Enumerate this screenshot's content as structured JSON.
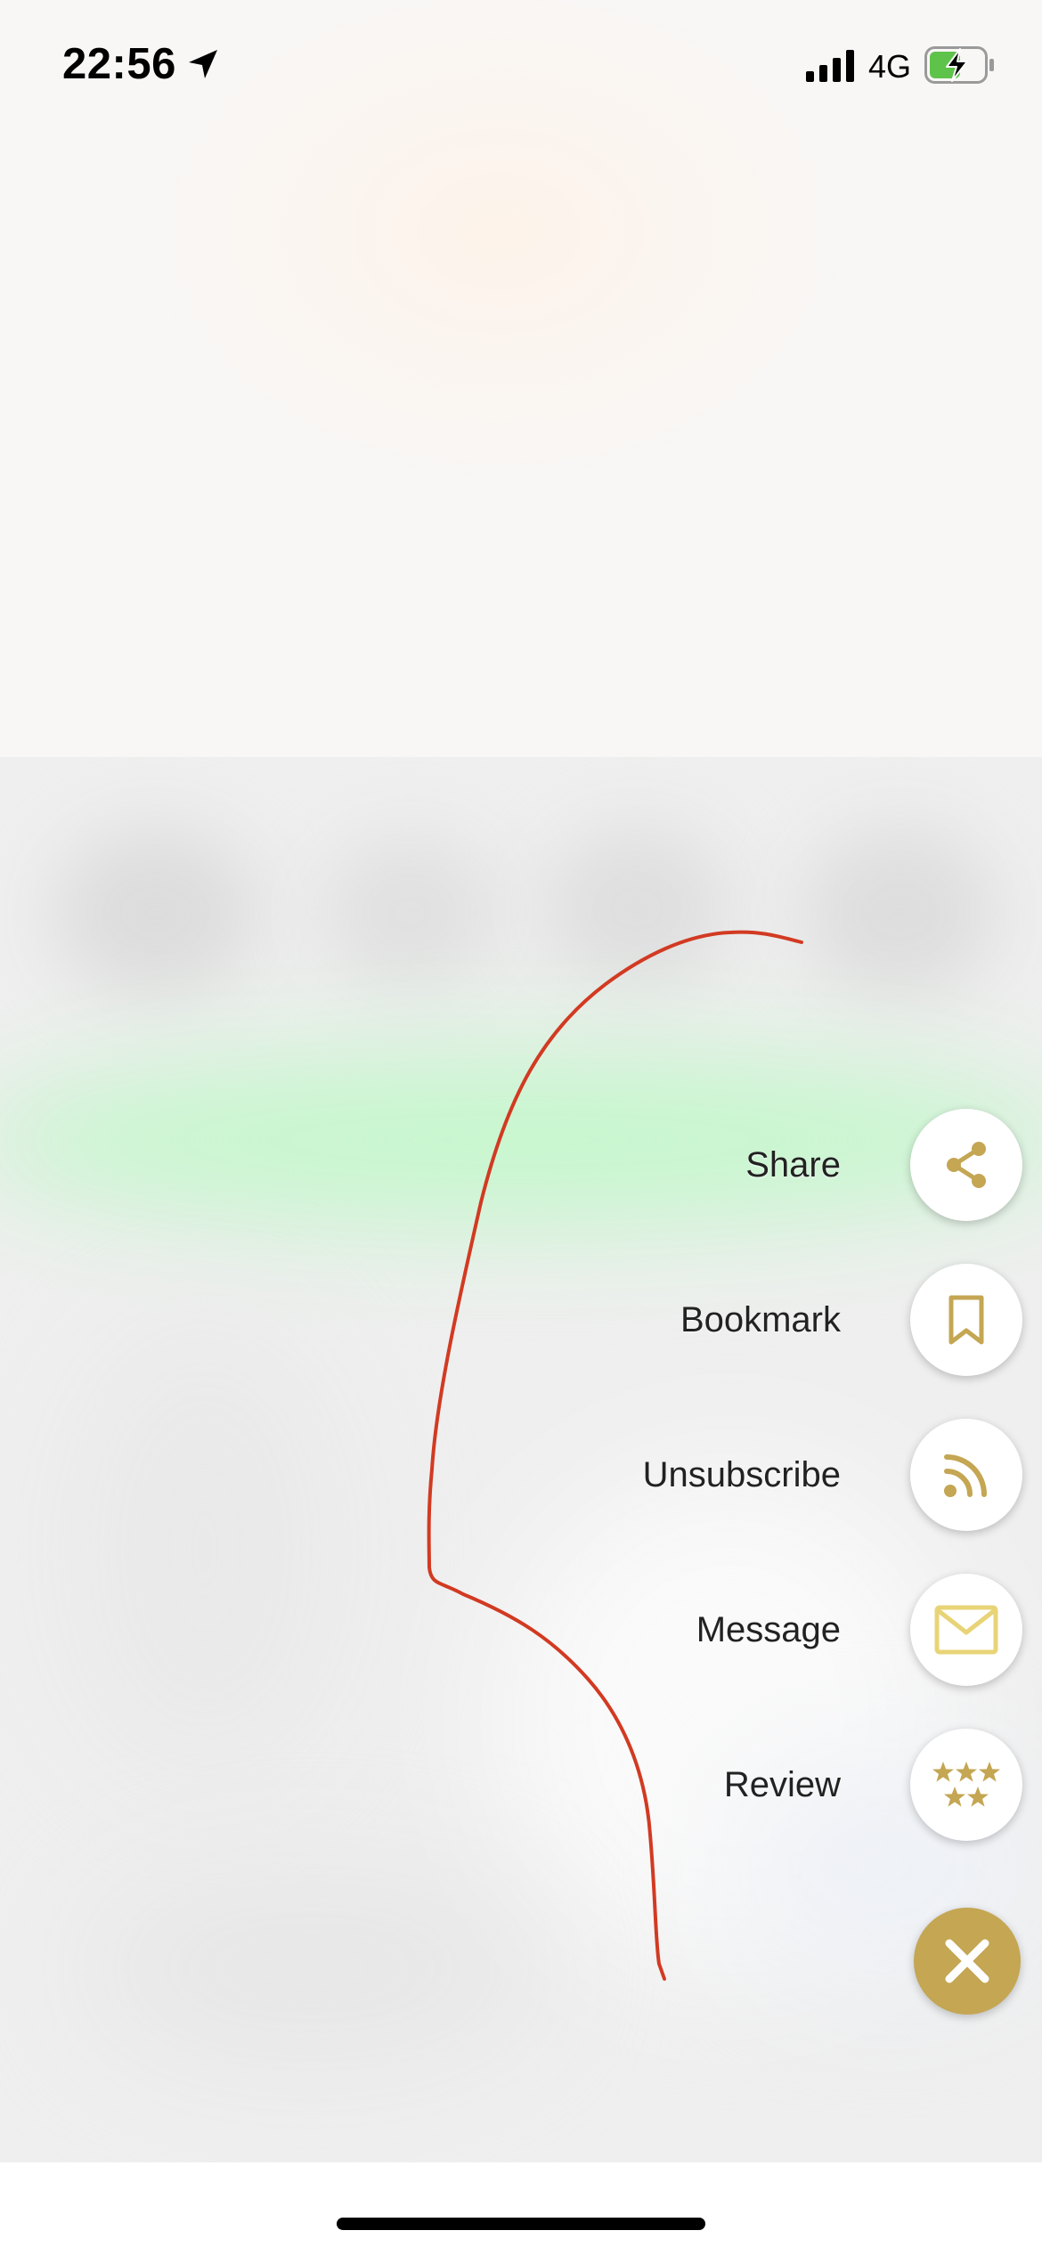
{
  "status_bar": {
    "time": "22:56",
    "network": "4G",
    "icons": [
      "location-arrow-icon",
      "signal-bars-icon",
      "battery-charging-icon"
    ]
  },
  "menu": {
    "items": [
      {
        "label": "Share",
        "icon": "share-icon"
      },
      {
        "label": "Bookmark",
        "icon": "bookmark-icon"
      },
      {
        "label": "Unsubscribe",
        "icon": "rss-feed-icon"
      },
      {
        "label": "Message",
        "icon": "envelope-icon"
      },
      {
        "label": "Review",
        "icon": "stars-icon"
      }
    ],
    "close_icon": "close-icon"
  },
  "colors": {
    "accent_gold": "#c4a653",
    "envelope_yellow": "#e8d477",
    "annotation_red": "#d23a22",
    "battery_green": "#5ec34a"
  }
}
